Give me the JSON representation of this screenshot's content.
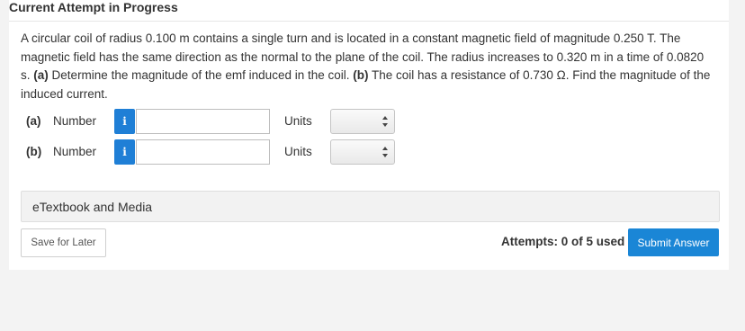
{
  "header": {
    "title": "Current Attempt in Progress"
  },
  "question": {
    "line1": "A circular coil of radius 0.100 m contains a single turn and is located in a constant magnetic field of magnitude 0.250 T. The magnetic field has the same direction as the normal to the plane of the coil. The radius increases to 0.320 m in a time of 0.0820 s.",
    "part_a_tag": "(a)",
    "part_a_text": "Determine the magnitude of the emf induced in the coil.",
    "part_b_tag": "(b)",
    "part_b_text": "The coil has a resistance of 0.730 Ω. Find the magnitude of the induced current."
  },
  "answers": [
    {
      "part": "(a)",
      "number_label": "Number",
      "info_icon": "i",
      "value": "",
      "units_label": "Units",
      "units_value": ""
    },
    {
      "part": "(b)",
      "number_label": "Number",
      "info_icon": "i",
      "value": "",
      "units_label": "Units",
      "units_value": ""
    }
  ],
  "etextbook": {
    "label": "eTextbook and Media"
  },
  "footer": {
    "save_label": "Save for Later",
    "attempts_text": "Attempts: 0 of 5 used",
    "submit_label": "Submit Answer"
  },
  "colors": {
    "accent": "#1a86d6",
    "info": "#1f7fd6"
  }
}
